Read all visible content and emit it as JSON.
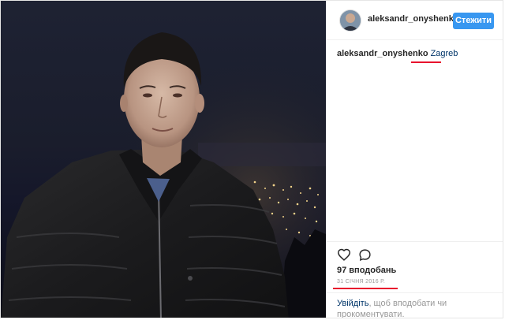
{
  "post": {
    "username": "aleksandr_onyshenko",
    "follow_label": "Стежити",
    "caption": {
      "username": "aleksandr_onyshenko",
      "location": "Zagreb"
    },
    "likes": "97 вподобань",
    "date": "31 СІЧНЯ 2016 Р.",
    "login_prompt": {
      "link": "Увійдіть",
      "rest": ", щоб вподобати чи прокоментувати."
    }
  },
  "icons": {
    "like": "heart-icon",
    "comment": "comment-icon"
  },
  "colors": {
    "follow_button": "#3897f0",
    "annotation_red": "#e8112d",
    "link": "#003569",
    "muted": "#999999"
  }
}
